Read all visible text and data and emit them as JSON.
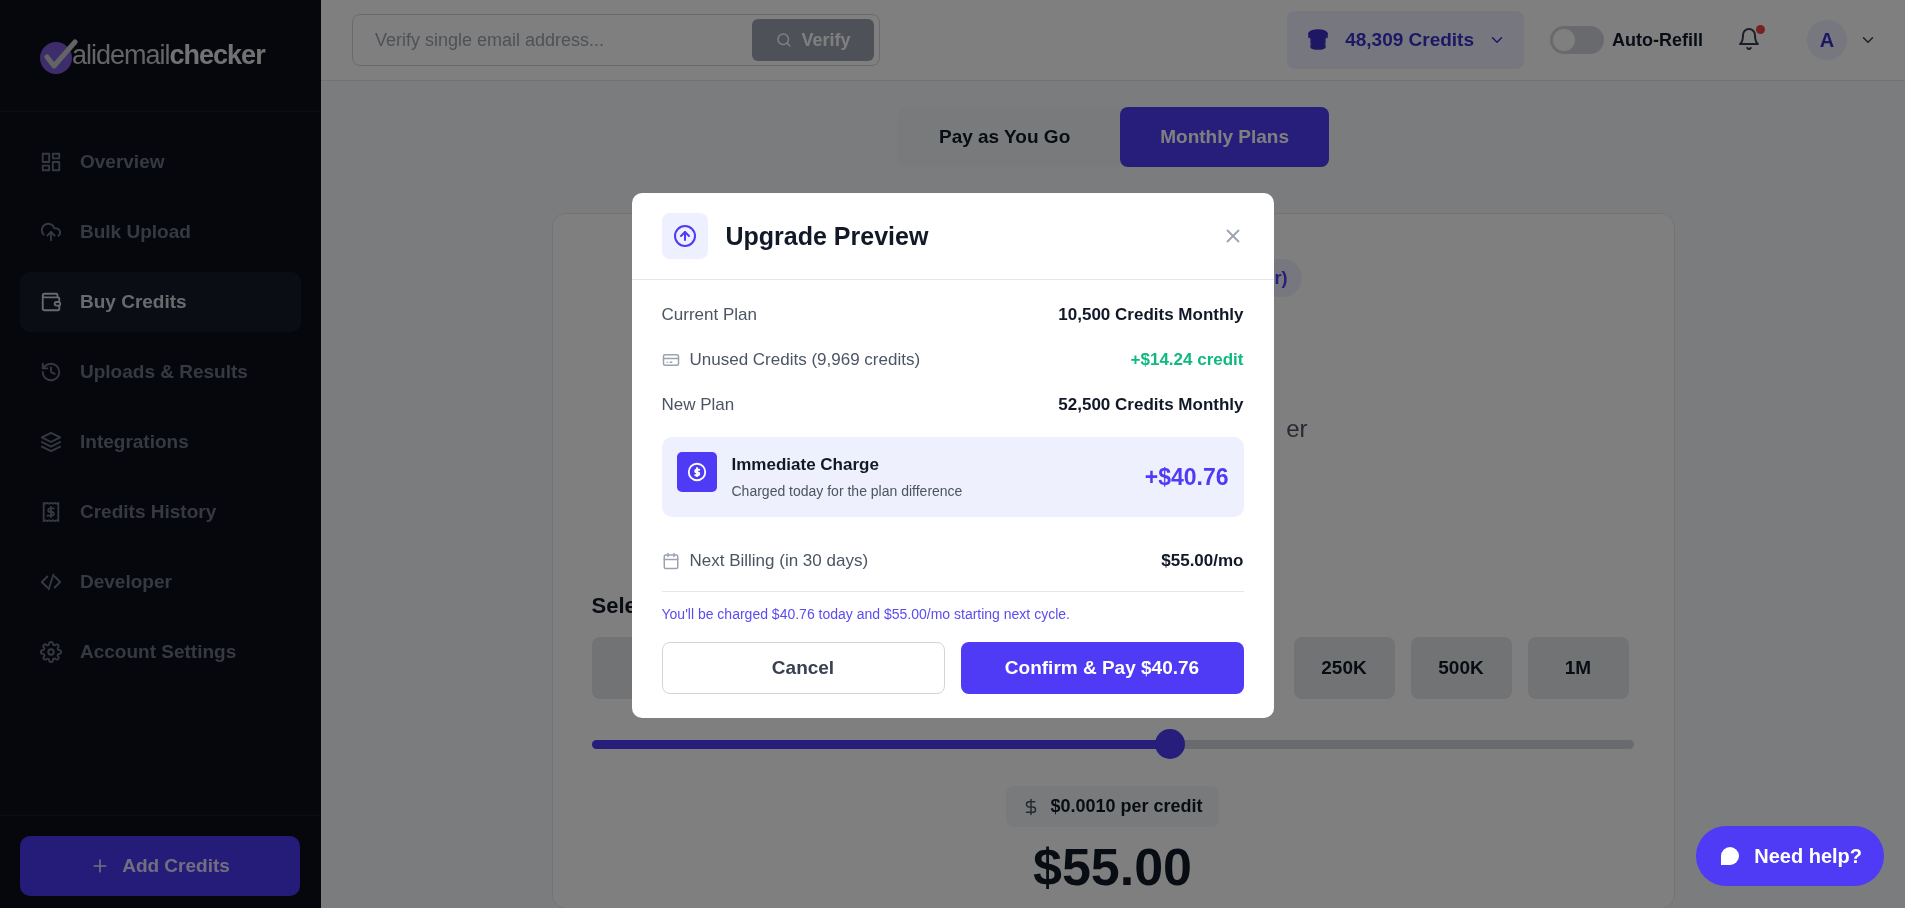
{
  "sidebar": {
    "logo_text": "alidemail**checker**",
    "items": [
      {
        "label": "Overview",
        "selected": false
      },
      {
        "label": "Bulk Upload",
        "selected": false
      },
      {
        "label": "Buy Credits",
        "selected": true
      },
      {
        "label": "Uploads & Results",
        "selected": false
      },
      {
        "label": "Integrations",
        "selected": false
      },
      {
        "label": "Credits History",
        "selected": false
      },
      {
        "label": "Developer",
        "selected": false
      },
      {
        "label": "Account Settings",
        "selected": false
      }
    ],
    "add_button": "Add Credits"
  },
  "header": {
    "search_placeholder": "Verify single email address...",
    "verify_button": "Verify",
    "credits": "48,309 Credits",
    "auto_refill": {
      "label": "Auto-Refill",
      "on": false
    },
    "notification_dot": true,
    "avatar": "A"
  },
  "tabs": [
    {
      "label": "Pay as You Go",
      "selected": false
    },
    {
      "label": "Monthly Plans",
      "selected": true
    }
  ],
  "card": {
    "pill_text": "r)",
    "text_fragment": "er",
    "heading": "Sele",
    "plan_options": [
      "250K",
      "500K",
      "1M"
    ],
    "slider": {
      "level": 0.555
    },
    "price_per_credit": "$0.0010 per credit",
    "price": "$55.00"
  },
  "modal": {
    "title": "Upgrade Preview",
    "rows": [
      {
        "kind": "plain",
        "label": "Current Plan",
        "value": "10,500 Credits Monthly"
      },
      {
        "kind": "credit",
        "label": "Unused Credits (9,969 credits)",
        "value": "+$14.24 credit"
      },
      {
        "kind": "plain",
        "label": "New Plan",
        "value": "52,500 Credits Monthly"
      }
    ],
    "charge": {
      "title": "Immediate Charge",
      "subtitle": "Charged today for the plan difference",
      "amount": "+$40.76"
    },
    "billing": {
      "label": "Next Billing (in 30 days)",
      "value": "$55.00/mo"
    },
    "note": "You'll be charged $40.76 today and $55.00/mo starting next cycle.",
    "cancel": "Cancel",
    "confirm": "Confirm & Pay $40.76"
  },
  "help_button": "Need help?"
}
